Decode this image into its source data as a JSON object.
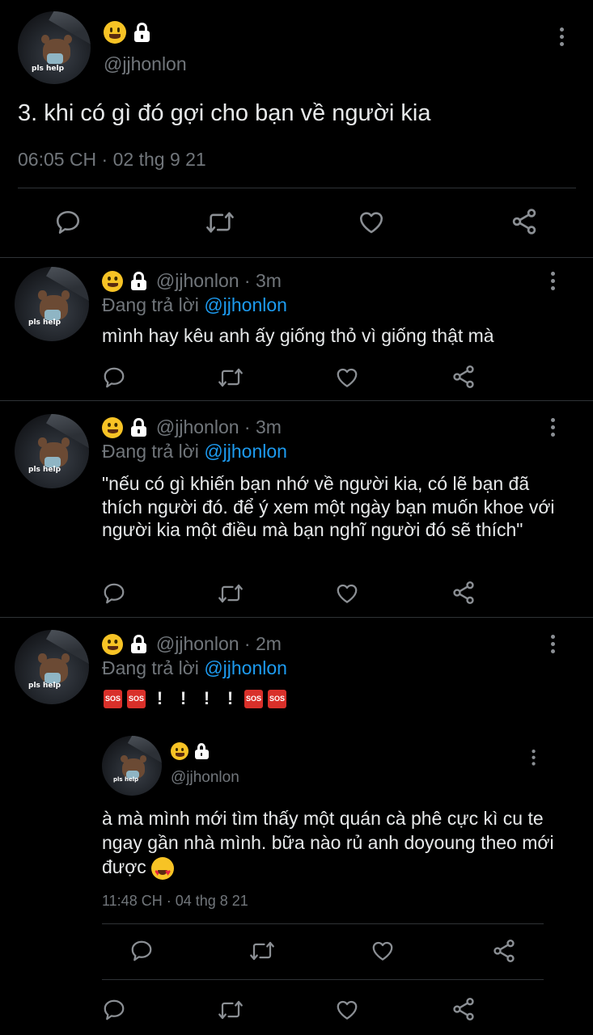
{
  "main_tweet": {
    "handle": "@jjhonlon",
    "avatar_caption": "pls help",
    "text": "3. khi có gì đó gợi cho bạn về người kia",
    "timestamp": "06:05 CH · 02 thg 9 21"
  },
  "replies": [
    {
      "handle_time": "@jjhonlon · 3m",
      "replying_prefix": "Đang trả lời",
      "replying_to": "@jjhonlon",
      "avatar_caption": "pls help",
      "text": "mình hay kêu anh ấy giống thỏ vì giống thật mà"
    },
    {
      "handle_time": "@jjhonlon · 3m",
      "replying_prefix": "Đang trả lời",
      "replying_to": "@jjhonlon",
      "avatar_caption": "pls help",
      "text": "\"nếu có gì khiến bạn nhớ về người kia, có lẽ bạn đã thích người đó. để ý xem một ngày bạn muốn khoe với người kia một điều mà bạn nghĩ người đó sẽ thích\""
    },
    {
      "handle_time": "@jjhonlon · 2m",
      "replying_prefix": "Đang trả lời",
      "replying_to": "@jjhonlon",
      "avatar_caption": "pls help",
      "sos_label": "SOS",
      "quoted": {
        "handle": "@jjhonlon",
        "avatar_caption": "pls help",
        "text": "à mà mình mới tìm thấy một quán cà phê cực kì cu te ngay gần nhà mình. bữa nào rủ anh doyoung theo mới được",
        "timestamp": "11:48 CH · 04 thg 8 21"
      }
    }
  ],
  "icons": [
    "reply-icon",
    "retweet-icon",
    "like-icon",
    "share-icon",
    "more-options-icon",
    "smile-emoji",
    "lock-emoji",
    "sos-emoji",
    "exclamation-emoji",
    "heart-eyes-emoji"
  ],
  "colors": {
    "background": "#000000",
    "text": "#e7e9ea",
    "muted": "#71767b",
    "link": "#1d9bf0",
    "divider": "#2f3336"
  }
}
